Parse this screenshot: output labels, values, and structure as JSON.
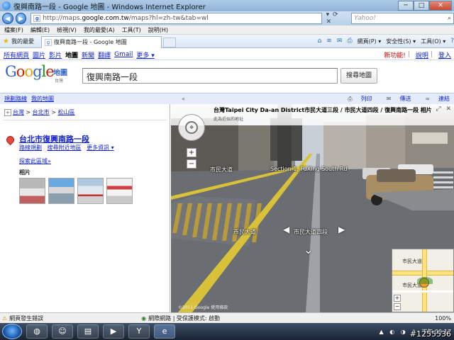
{
  "window": {
    "title": "復興南路一段 - Google 地圖 - Windows Internet Explorer",
    "btn_min": "─",
    "btn_max": "□",
    "btn_close": "✕"
  },
  "address_bar": {
    "url_prefix": "http://maps.",
    "url_domain": "google.com.tw",
    "url_rest": "/maps?hl=zh-tw&tab=wl",
    "search_placeholder": "Yahoo!",
    "tools": "▾ ⟳ ✕"
  },
  "menu": [
    "檔案(F)",
    "編輯(E)",
    "檢視(V)",
    "我的最愛(A)",
    "工具(T)",
    "說明(H)"
  ],
  "favorites": {
    "label": "我的最愛",
    "tab_title": "復興南路一段 - Google 地圖",
    "commands": [
      "網頁(P) ▾",
      "安全性(S) ▾",
      "工具(O) ▾"
    ]
  },
  "google_links": {
    "items": [
      "所有網頁",
      "圖片",
      "影片",
      "地圖",
      "新聞",
      "翻譯",
      "Gmail",
      "更多 ▾"
    ],
    "active_index": 3,
    "new_feature": "新功能!",
    "help": "說明",
    "login": "登入"
  },
  "header": {
    "logo_letters": [
      "G",
      "o",
      "o",
      "g",
      "l",
      "e"
    ],
    "product": "地圖",
    "region": "台灣",
    "search_value": "復興南路一段",
    "search_button": "搜尋地圖"
  },
  "subtoolbar": {
    "directions": "規劃路線",
    "my_maps": "我的地圖",
    "collapse": "«",
    "print": "列印",
    "send": "傳送",
    "link": "連結"
  },
  "left_panel": {
    "breadcrumb": [
      "台灣",
      "台北市",
      "松山區"
    ],
    "breadcrumb_sep": ">",
    "place_title": "台北市復興南路一段",
    "place_links": [
      "路線規劃",
      "搜尋附近地區",
      "更多資訊 ▾"
    ],
    "explore": "探索此區域»",
    "photos_label": "相片"
  },
  "street_view": {
    "address_bold": "台灣Taipei City Da-an  District市民大道三段 / 市民大道四段 / 復興南路一段",
    "address_tail": "相片",
    "address_sub": "此為近似的地址",
    "label_road1": "市民大道",
    "label_section": "Section 1, FuXing South Rd",
    "label_road2": "市民大道",
    "label_road3": "市民大道四段",
    "copyright": "©2011 Google",
    "copyright_2": "使用條款",
    "minimap_label1": "市民大道",
    "minimap_label2": "市民大道"
  },
  "status_bar": {
    "text": "網頁發生錯誤",
    "zone": "網際網路 | 受保護模式: 啟動",
    "zoom": "100%"
  },
  "taskbar": {
    "clock_time": "下午 09:17",
    "watermark": "#1255536"
  }
}
